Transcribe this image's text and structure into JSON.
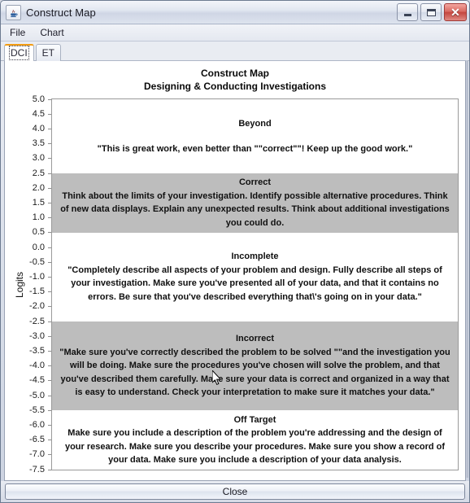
{
  "window": {
    "title": "Construct Map",
    "app_icon": "java-coffee-cup-icon",
    "minimize_label": "Minimize",
    "maximize_label": "Maximize",
    "close_label": "Close"
  },
  "menubar": {
    "items": [
      {
        "label": "File"
      },
      {
        "label": "Chart"
      }
    ]
  },
  "tabs": {
    "selected": "DCI",
    "items": [
      {
        "label": "DCI",
        "selected": true
      },
      {
        "label": "ET",
        "selected": false
      }
    ]
  },
  "chart_data": {
    "type": "bar",
    "title": "Construct Map",
    "subtitle": "Designing & Conducting Investigations",
    "xlabel": "",
    "ylabel": "Logits",
    "ylim": [
      -7.5,
      5.0
    ],
    "grid": false,
    "legend": "none",
    "tick_step": 0.5,
    "yticks": [
      "5.0",
      "4.5",
      "4.0",
      "3.5",
      "3.0",
      "2.5",
      "2.0",
      "1.5",
      "1.0",
      "0.5",
      "0.0",
      "-0.5",
      "-1.0",
      "-1.5",
      "-2.0",
      "-2.5",
      "-3.0",
      "-3.5",
      "-4.0",
      "-4.5",
      "-5.0",
      "-5.5",
      "-6.0",
      "-6.5",
      "-7.0",
      "-7.5"
    ],
    "categories": [
      "Beyond",
      "Correct",
      "Incomplete",
      "Incorrect",
      "Off Target"
    ],
    "bands": [
      {
        "label": "Beyond",
        "top": 5.0,
        "bottom": 2.5,
        "shaded": false,
        "color": "#ffffff",
        "description": "\"This is great work, even better than \"\"correct\"\"! Keep up the good work.\""
      },
      {
        "label": "Correct",
        "top": 2.5,
        "bottom": 0.5,
        "shaded": true,
        "color": "#bdbdbd",
        "description": "Think about the limits of your investigation. Identify possible alternative procedures. Think of new data displays. Explain any unexpected results. Think about additional investigations you could do."
      },
      {
        "label": "Incomplete",
        "top": 0.5,
        "bottom": -2.5,
        "shaded": false,
        "color": "#ffffff",
        "description": "\"Completely describe all aspects of your problem and design. Fully describe all steps of your investigation. Make sure you've presented all of your data, and that it contains no errors. Be sure that you've described everything that\\'s going on in your data.\""
      },
      {
        "label": "Incorrect",
        "top": -2.5,
        "bottom": -5.5,
        "shaded": true,
        "color": "#bdbdbd",
        "description": "\"Make sure you've correctly described the problem to be solved \"\"and the investigation you will be doing. Make sure the procedures you've chosen will solve the problem, and that you've described them carefully. Make sure your data is correct and organized in a way that is easy to understand. Check your interpretation to make sure it matches your data.\""
      },
      {
        "label": "Off Target",
        "top": -5.5,
        "bottom": -7.5,
        "shaded": false,
        "color": "#ffffff",
        "description": "Make sure you include a description of the problem you're addressing and the design of your research. Make sure you describe your procedures. Make sure you show a record of your data. Make sure you include a description of your data analysis."
      }
    ]
  },
  "footer": {
    "close_label": "Close"
  },
  "colors": {
    "band_shaded": "#bdbdbd",
    "band_plain": "#ffffff",
    "tab_accent": "#f39c12",
    "close_button_red": "#c4463f"
  }
}
